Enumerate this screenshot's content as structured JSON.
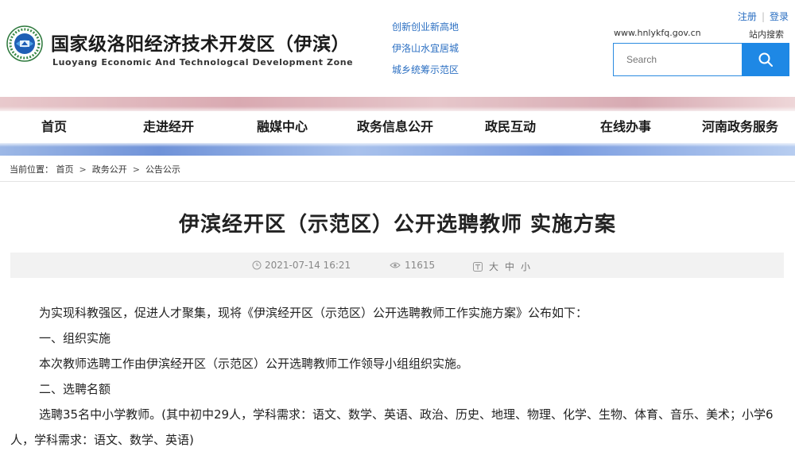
{
  "header": {
    "site_title": "国家级洛阳经济技术开发区（伊滨）",
    "site_subtitle": "Luoyang Economic And Technologcal Development Zone",
    "slogans": [
      "创新创业新高地",
      "伊洛山水宜居城",
      "城乡统筹示范区"
    ],
    "register_label": "注册",
    "login_label": "登录",
    "site_url": "www.hnlykfq.gov.cn",
    "site_search_label": "站内搜索",
    "search_placeholder": "Search"
  },
  "nav": {
    "items": [
      "首页",
      "走进经开",
      "融媒中心",
      "政务信息公开",
      "政民互动",
      "在线办事",
      "河南政务服务"
    ]
  },
  "breadcrumb": {
    "prefix": "当前位置：",
    "items": [
      "首页",
      "政务公开",
      "公告公示"
    ]
  },
  "article": {
    "title": "伊滨经开区（示范区）公开选聘教师 实施方案",
    "date": "2021-07-14 16:21",
    "views": "11615",
    "font_size_options": [
      "大",
      "中",
      "小"
    ],
    "paragraphs": [
      "为实现科教强区，促进人才聚集，现将《伊滨经开区（示范区）公开选聘教师工作实施方案》公布如下：",
      "一、组织实施",
      "本次教师选聘工作由伊滨经开区（示范区）公开选聘教师工作领导小组组织实施。",
      "二、选聘名额",
      "选聘35名中小学教师。(其中初中29人，学科需求：语文、数学、英语、政治、历史、地理、物理、化学、生物、体育、音乐、美术；小学6人，学科需求：语文、数学、英语)"
    ]
  },
  "colors": {
    "accent": "#1e88e5",
    "link": "#2b6fc2"
  },
  "icons": [
    "emblem-logo",
    "search-icon",
    "clock-icon",
    "eye-icon",
    "font-size-icon"
  ]
}
